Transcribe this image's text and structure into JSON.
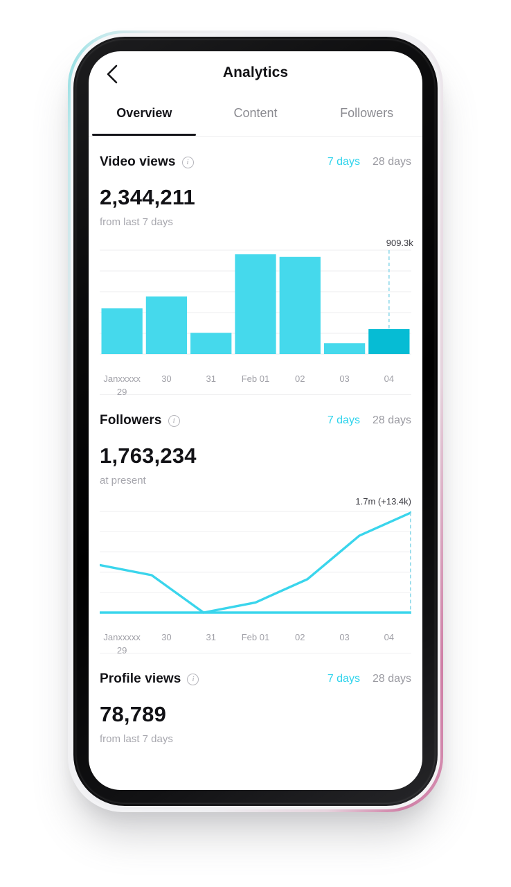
{
  "app": {
    "title": "Analytics",
    "back_icon": "chevron-left-icon"
  },
  "tabs": [
    {
      "label": "Overview",
      "active": true
    },
    {
      "label": "Content",
      "active": false
    },
    {
      "label": "Followers",
      "active": false
    }
  ],
  "range_options": {
    "short": "7 days",
    "long": "28 days",
    "selected": "7 days"
  },
  "sections": [
    {
      "id": "video-views",
      "title": "Video views",
      "info_icon": "info-icon",
      "value": "2,344,211",
      "subtitle": "from last 7 days"
    },
    {
      "id": "followers",
      "title": "Followers",
      "info_icon": "info-icon",
      "value": "1,763,234",
      "subtitle": "at present"
    },
    {
      "id": "profile-views",
      "title": "Profile views",
      "info_icon": "info-icon",
      "value": "78,789",
      "subtitle": "from last 7 days"
    }
  ],
  "colors": {
    "accent": "#2ed3ec",
    "accent_selected": "#06bcd4",
    "bar": "#45d9ec",
    "line": "#3ad5ec",
    "grid": "#f0f0f2",
    "text_dark": "#121216",
    "text_muted": "#a0a0a7"
  },
  "chart_data": [
    {
      "id": "video-views-chart",
      "type": "bar",
      "title": "Video views",
      "xlabel": "",
      "ylabel": "",
      "grid": true,
      "categories": [
        "Janxxxxx 29",
        "30",
        "31",
        "Feb 01",
        "02",
        "03",
        "04"
      ],
      "category_lines": [
        [
          "Janxxxxx",
          "29"
        ],
        [
          "30"
        ],
        [
          "31"
        ],
        [
          "Feb 01"
        ],
        [
          "02"
        ],
        [
          "03"
        ],
        [
          "04"
        ]
      ],
      "values": [
        440,
        555,
        205,
        960,
        935,
        105,
        240
      ],
      "ylim": [
        0,
        1000
      ],
      "selected_index": 6,
      "annotation": {
        "text": "909.3k",
        "at_index": 6,
        "dashed_guide": true
      }
    },
    {
      "id": "followers-chart",
      "type": "line",
      "title": "Followers",
      "xlabel": "",
      "ylabel": "",
      "grid": true,
      "categories": [
        "Janxxxxx 29",
        "30",
        "31",
        "Feb 01",
        "02",
        "03",
        "04"
      ],
      "category_lines": [
        [
          "Janxxxxx",
          "29"
        ],
        [
          "30"
        ],
        [
          "31"
        ],
        [
          "Feb 01"
        ],
        [
          "02"
        ],
        [
          "03"
        ],
        [
          "04"
        ]
      ],
      "ylim": [
        0,
        100
      ],
      "series": [
        {
          "name": "followers-total",
          "values": [
            0,
            0,
            0,
            0,
            0,
            0,
            0
          ]
        },
        {
          "name": "followers-net",
          "values": [
            47,
            37,
            0,
            10,
            33,
            76,
            99
          ]
        }
      ],
      "annotation": {
        "text": "1.7m (+13.4k)",
        "at_index": 6,
        "dashed_guide": true
      }
    }
  ]
}
